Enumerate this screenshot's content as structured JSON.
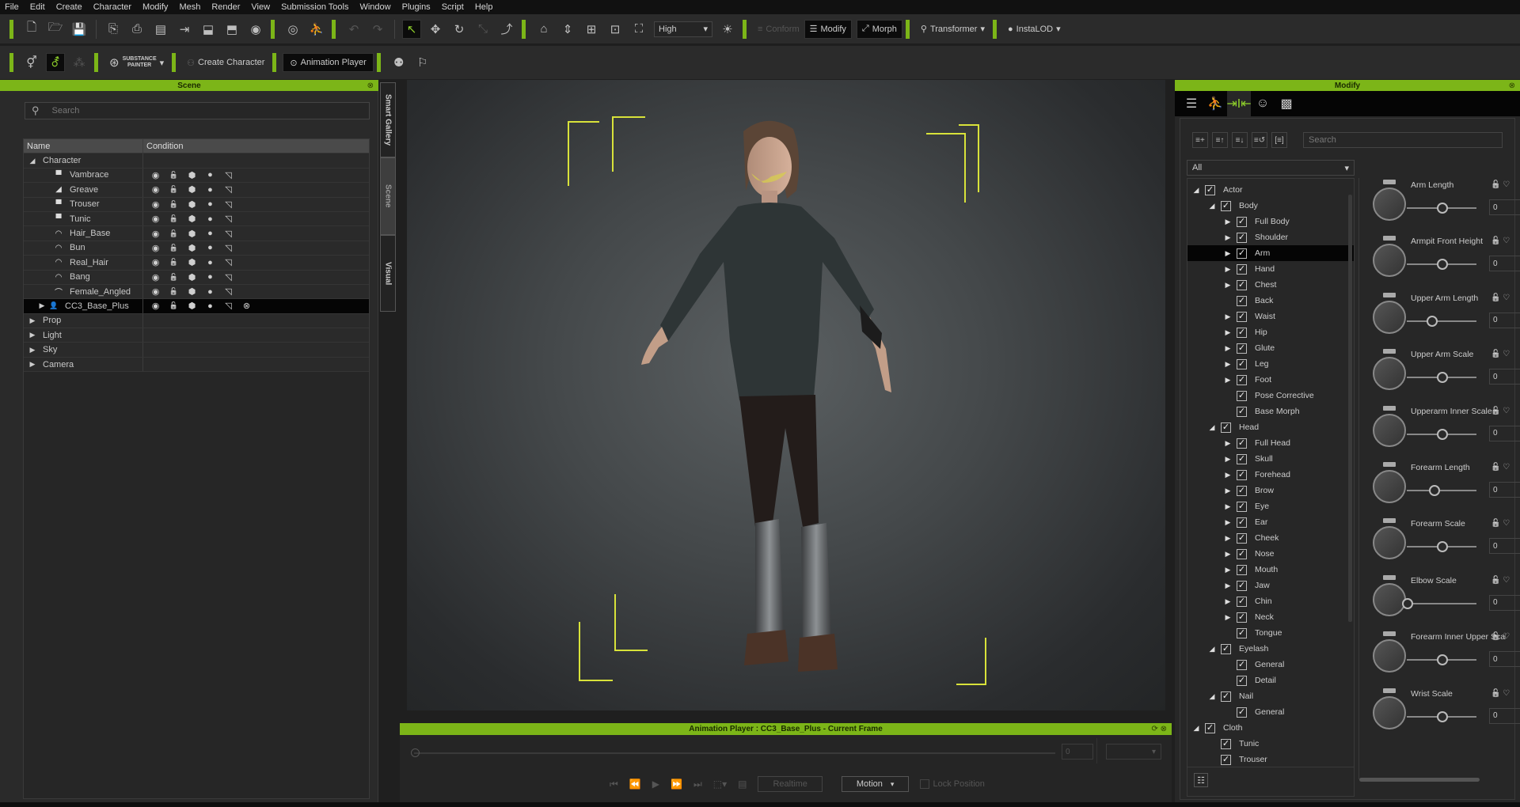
{
  "menu": [
    "File",
    "Edit",
    "Create",
    "Character",
    "Modify",
    "Mesh",
    "Render",
    "View",
    "Submission Tools",
    "Window",
    "Plugins",
    "Script",
    "Help"
  ],
  "toolbar1": {
    "quality_dropdown": "High",
    "buttons": {
      "conform": "Conform",
      "modify": "Modify",
      "morph": "Morph",
      "transformer": "Transformer",
      "instalod": "InstaLOD"
    }
  },
  "toolbar2": {
    "substance_line1": "SUBSTANCE",
    "substance_line2": "PAINTER",
    "create_character": "Create Character",
    "animation_player": "Animation Player"
  },
  "scene_panel": {
    "title": "Scene",
    "search_placeholder": "Search",
    "columns": [
      "Name",
      "Condition"
    ],
    "rows": [
      {
        "name": "Character",
        "level": 0,
        "expanded": true,
        "icon": "folder"
      },
      {
        "name": "Vambrace",
        "level": 2,
        "icon": "cloth"
      },
      {
        "name": "Greave",
        "level": 2,
        "icon": "shoe"
      },
      {
        "name": "Trouser",
        "level": 2,
        "icon": "cloth"
      },
      {
        "name": "Tunic",
        "level": 2,
        "icon": "cloth"
      },
      {
        "name": "Hair_Base",
        "level": 2,
        "icon": "hair"
      },
      {
        "name": "Bun",
        "level": 2,
        "icon": "hair"
      },
      {
        "name": "Real_Hair",
        "level": 2,
        "icon": "hair"
      },
      {
        "name": "Bang",
        "level": 2,
        "icon": "hair"
      },
      {
        "name": "Female_Angled",
        "level": 2,
        "icon": "brow"
      },
      {
        "name": "CC3_Base_Plus",
        "level": 1,
        "icon": "avatar",
        "selected": true
      },
      {
        "name": "Prop",
        "level": 0
      },
      {
        "name": "Light",
        "level": 0
      },
      {
        "name": "Sky",
        "level": 0
      },
      {
        "name": "Camera",
        "level": 0
      }
    ]
  },
  "side_tabs": [
    "Smart Gallery",
    "Scene",
    "Visual"
  ],
  "animation_player": {
    "title": "Animation Player : CC3_Base_Plus - Current Frame",
    "frame_value": "0",
    "realtime_label": "Realtime",
    "motion_label": "Motion",
    "lock_position_label": "Lock Position"
  },
  "modify_panel": {
    "title": "Modify",
    "search_placeholder": "Search",
    "filter": "All",
    "tree": [
      {
        "label": "Actor",
        "level": 0,
        "toggle": "open"
      },
      {
        "label": "Body",
        "level": 1,
        "toggle": "open"
      },
      {
        "label": "Full Body",
        "level": 2,
        "toggle": "closed"
      },
      {
        "label": "Shoulder",
        "level": 2,
        "toggle": "closed"
      },
      {
        "label": "Arm",
        "level": 2,
        "toggle": "closed",
        "selected": true
      },
      {
        "label": "Hand",
        "level": 2,
        "toggle": "closed"
      },
      {
        "label": "Chest",
        "level": 2,
        "toggle": "closed"
      },
      {
        "label": "Back",
        "level": 2,
        "toggle": "none"
      },
      {
        "label": "Waist",
        "level": 2,
        "toggle": "closed"
      },
      {
        "label": "Hip",
        "level": 2,
        "toggle": "closed"
      },
      {
        "label": "Glute",
        "level": 2,
        "toggle": "closed"
      },
      {
        "label": "Leg",
        "level": 2,
        "toggle": "closed"
      },
      {
        "label": "Foot",
        "level": 2,
        "toggle": "closed"
      },
      {
        "label": "Pose Corrective",
        "level": 2,
        "toggle": "none"
      },
      {
        "label": "Base Morph",
        "level": 2,
        "toggle": "none"
      },
      {
        "label": "Head",
        "level": 1,
        "toggle": "open"
      },
      {
        "label": "Full Head",
        "level": 2,
        "toggle": "closed"
      },
      {
        "label": "Skull",
        "level": 2,
        "toggle": "closed"
      },
      {
        "label": "Forehead",
        "level": 2,
        "toggle": "closed"
      },
      {
        "label": "Brow",
        "level": 2,
        "toggle": "closed"
      },
      {
        "label": "Eye",
        "level": 2,
        "toggle": "closed"
      },
      {
        "label": "Ear",
        "level": 2,
        "toggle": "closed"
      },
      {
        "label": "Cheek",
        "level": 2,
        "toggle": "closed"
      },
      {
        "label": "Nose",
        "level": 2,
        "toggle": "closed"
      },
      {
        "label": "Mouth",
        "level": 2,
        "toggle": "closed"
      },
      {
        "label": "Jaw",
        "level": 2,
        "toggle": "closed"
      },
      {
        "label": "Chin",
        "level": 2,
        "toggle": "closed"
      },
      {
        "label": "Neck",
        "level": 2,
        "toggle": "closed"
      },
      {
        "label": "Tongue",
        "level": 2,
        "toggle": "none"
      },
      {
        "label": "Eyelash",
        "level": 1,
        "toggle": "open"
      },
      {
        "label": "General",
        "level": 2,
        "toggle": "none"
      },
      {
        "label": "Detail",
        "level": 2,
        "toggle": "none"
      },
      {
        "label": "Nail",
        "level": 1,
        "toggle": "open"
      },
      {
        "label": "General",
        "level": 2,
        "toggle": "none"
      },
      {
        "label": "Cloth",
        "level": 0,
        "toggle": "open"
      },
      {
        "label": "Tunic",
        "level": 1,
        "toggle": "none"
      },
      {
        "label": "Trouser",
        "level": 1,
        "toggle": "none"
      }
    ],
    "sliders": [
      {
        "label": "Arm Length",
        "value": "0",
        "position": 0.5
      },
      {
        "label": "Armpit Front Height",
        "value": "0",
        "position": 0.5
      },
      {
        "label": "Upper Arm Length",
        "value": "0",
        "position": 0.35
      },
      {
        "label": "Upper Arm Scale",
        "value": "0",
        "position": 0.5
      },
      {
        "label": "Upperarm Inner Scale",
        "value": "0",
        "position": 0.5
      },
      {
        "label": "Forearm Length",
        "value": "0",
        "position": 0.39
      },
      {
        "label": "Forearm Scale",
        "value": "0",
        "position": 0.5
      },
      {
        "label": "Elbow Scale",
        "value": "0",
        "position": 0.0
      },
      {
        "label": "Forearm Inner Upper Scale",
        "value": "0",
        "position": 0.5
      },
      {
        "label": "Wrist Scale",
        "value": "0",
        "position": 0.5
      }
    ]
  }
}
